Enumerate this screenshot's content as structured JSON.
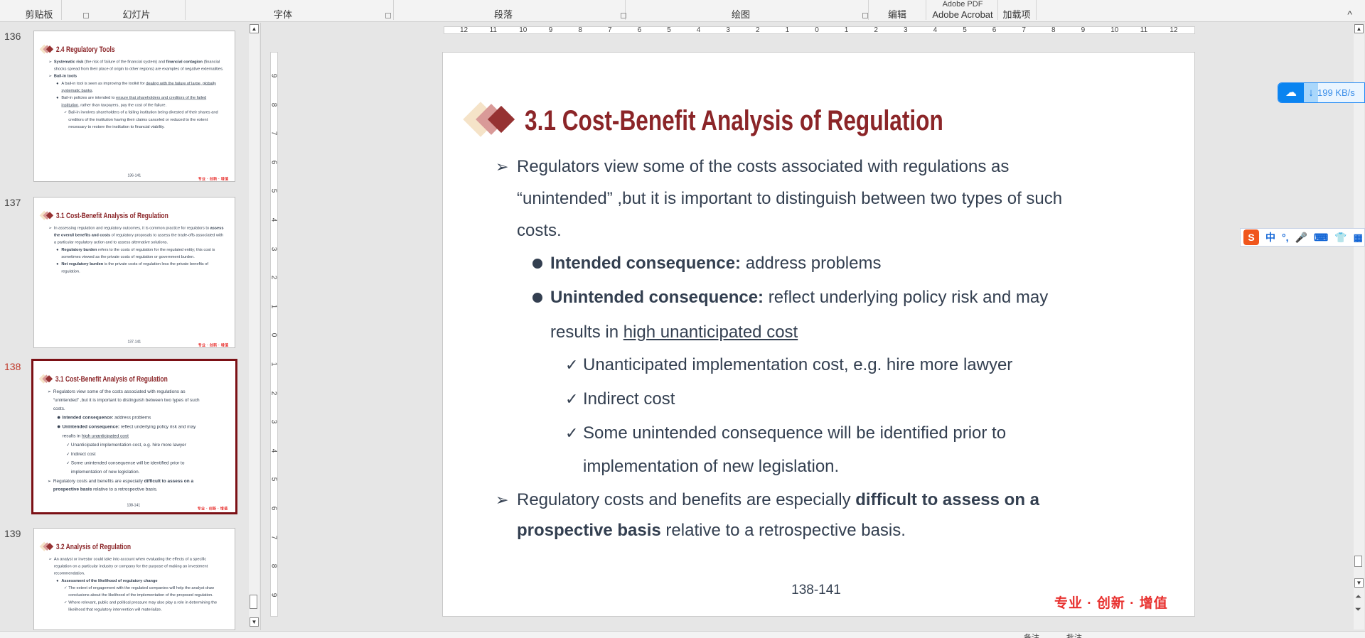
{
  "ribbon": {
    "groups": [
      "剪贴板",
      "幻灯片",
      "字体",
      "段落",
      "绘图",
      "编辑",
      "Adobe Acrobat",
      "加载项"
    ],
    "top_clipped": [
      "Adobe PDF"
    ],
    "collapse": "^"
  },
  "thumbnails": [
    {
      "number": "136",
      "title": "2.4 Regulatory Tools",
      "page": "136-141",
      "slogan": "专业 · 创新 · 增值",
      "paras": [
        {
          "level": 0,
          "mark": "➢",
          "runs": [
            {
              "t": "Systematic risk",
              "b": true
            },
            {
              "t": " (the risk of failure of the financial system) and "
            },
            {
              "t": "financial contagion",
              "b": true
            },
            {
              "t": " (financial shocks spread from their place of origin to other regions) are examples of negative externalities."
            }
          ]
        },
        {
          "level": 0,
          "mark": "➢",
          "runs": [
            {
              "t": "Bail-in tools",
              "b": true
            }
          ]
        },
        {
          "level": 1,
          "mark": "●",
          "runs": [
            {
              "t": "A bail-in tool is seen as improving the toolkit for "
            },
            {
              "t": "dealing with the failure of large, globally systematic banks",
              "u": true
            },
            {
              "t": "."
            }
          ]
        },
        {
          "level": 1,
          "mark": "●",
          "runs": [
            {
              "t": "Bail-in policies are intended to "
            },
            {
              "t": "ensure that shareholders and creditors of the failed institution",
              "u": true
            },
            {
              "t": ", rather than taxpayers, pay the cost of the failure."
            }
          ]
        },
        {
          "level": 2,
          "mark": "✓",
          "runs": [
            {
              "t": "Bail-in involves shareholders of a failing institution being divested of their shares and creditors of the institution having their claims canceled or reduced to the extent necessary to restore the institution to financial viability."
            }
          ]
        }
      ]
    },
    {
      "number": "137",
      "title": "3.1 Cost-Benefit Analysis of Regulation",
      "page": "137-141",
      "slogan": "专业 · 创新 · 增值",
      "paras": [
        {
          "level": 0,
          "mark": "➢",
          "runs": [
            {
              "t": "In assessing regulation and regulatory outcomes, it is common practice for regulators to "
            },
            {
              "t": "assess the overall benefits and costs",
              "b": true
            },
            {
              "t": " of regulatory proposals to assess the trade-offs associated with a particular regulatory action and to assess alternative solutions."
            }
          ]
        },
        {
          "level": 1,
          "mark": "●",
          "runs": [
            {
              "t": "Regulatory burden",
              "b": true
            },
            {
              "t": " refers to the costs of regulation for the regulated entity; this cost is sometimes viewed as the private costs of regulation or government burden."
            }
          ]
        },
        {
          "level": 1,
          "mark": "●",
          "runs": [
            {
              "t": "Net regulatory burden",
              "b": true
            },
            {
              "t": " is the private costs of regulation less the private benefits of regulation."
            }
          ]
        }
      ]
    },
    {
      "number": "138",
      "selected": true
    },
    {
      "number": "139",
      "title": "3.2 Analysis of Regulation",
      "page": "139-141",
      "slogan": "专业 · 创新 · 增值",
      "paras": [
        {
          "level": 0,
          "mark": "➢",
          "runs": [
            {
              "t": "An analyst or investor could take into account when evaluating the effects of a specific regulation on a particular industry or company for the purpose of making an investment recommendation."
            }
          ]
        },
        {
          "level": 1,
          "mark": "●",
          "runs": [
            {
              "t": "Assessment of the likelihood of regulatory change",
              "b": true
            }
          ]
        },
        {
          "level": 2,
          "mark": "✓",
          "runs": [
            {
              "t": "The extent of engagement with the regulated companies will help the analyst draw conclusions about the likelihood of the implementation of the proposed regulation."
            }
          ]
        },
        {
          "level": 2,
          "mark": "✓",
          "runs": [
            {
              "t": "Where relevant, public and political pressure may also play a role in determining the likelihood that regulatory intervention will materialize."
            }
          ]
        }
      ]
    }
  ],
  "main": {
    "title": "3.1 Cost-Benefit Analysis of Regulation",
    "page": "138-141",
    "slogan": "专业 · 创新 · 增值",
    "lines": [
      {
        "kind": "arrow",
        "runs": [
          {
            "t": "Regulators view some of the costs associated with regulations as"
          }
        ]
      },
      {
        "kind": "c0",
        "runs": [
          {
            "t": "“unintended” ,but it is important to distinguish between two types of such"
          }
        ]
      },
      {
        "kind": "c0",
        "runs": [
          {
            "t": "costs."
          }
        ]
      },
      {
        "kind": "dot",
        "runs": [
          {
            "t": "Intended consequence:",
            "b": true
          },
          {
            "t": " address problems"
          }
        ]
      },
      {
        "kind": "dot",
        "runs": [
          {
            "t": "Unintended consequence:",
            "b": true
          },
          {
            "t": " reflect underlying policy risk and may"
          }
        ]
      },
      {
        "kind": "c1",
        "runs": [
          {
            "t": "results in "
          },
          {
            "t": "high unanticipated cost",
            "u": true
          }
        ]
      },
      {
        "kind": "check",
        "runs": [
          {
            "t": "Unanticipated implementation cost, e.g. hire more lawyer"
          }
        ]
      },
      {
        "kind": "check",
        "runs": [
          {
            "t": "Indirect cost"
          }
        ]
      },
      {
        "kind": "check",
        "runs": [
          {
            "t": "Some unintended consequence will be identified prior to"
          }
        ]
      },
      {
        "kind": "c2",
        "runs": [
          {
            "t": "implementation of new legislation."
          }
        ]
      },
      {
        "kind": "arrow",
        "runs": [
          {
            "t": "Regulatory costs and benefits are especially "
          },
          {
            "t": "difficult to assess on a",
            "b": true
          }
        ]
      },
      {
        "kind": "c0",
        "runs": [
          {
            "t": "prospective basis",
            "b": true
          },
          {
            "t": " relative to a retrospective basis."
          }
        ]
      }
    ],
    "marks": {
      "arrow": "➢",
      "check": "✓"
    }
  },
  "ruler": {
    "h": [
      "12",
      "11",
      "10",
      "9",
      "8",
      "7",
      "6",
      "5",
      "4",
      "3",
      "2",
      "1",
      "0",
      "1",
      "2",
      "3",
      "4",
      "5",
      "6",
      "7",
      "8",
      "9",
      "10",
      "11",
      "12"
    ],
    "v": [
      "9",
      "8",
      "7",
      "6",
      "5",
      "4",
      "3",
      "2",
      "1",
      "0",
      "1",
      "2",
      "3",
      "4",
      "5",
      "6",
      "7",
      "8",
      "9"
    ]
  },
  "widgets": {
    "download_speed": "199 KB/s",
    "ime_items": [
      "S",
      "中",
      "°,",
      "🎤",
      "⌨",
      "👕",
      "▦"
    ]
  },
  "statusbar": {
    "notes": "备注",
    "comments": "批注"
  },
  "colors": {
    "title": "#8b2528",
    "body": "#333f50",
    "slogan": "#e8312f",
    "selected_border": "#7b1015"
  }
}
